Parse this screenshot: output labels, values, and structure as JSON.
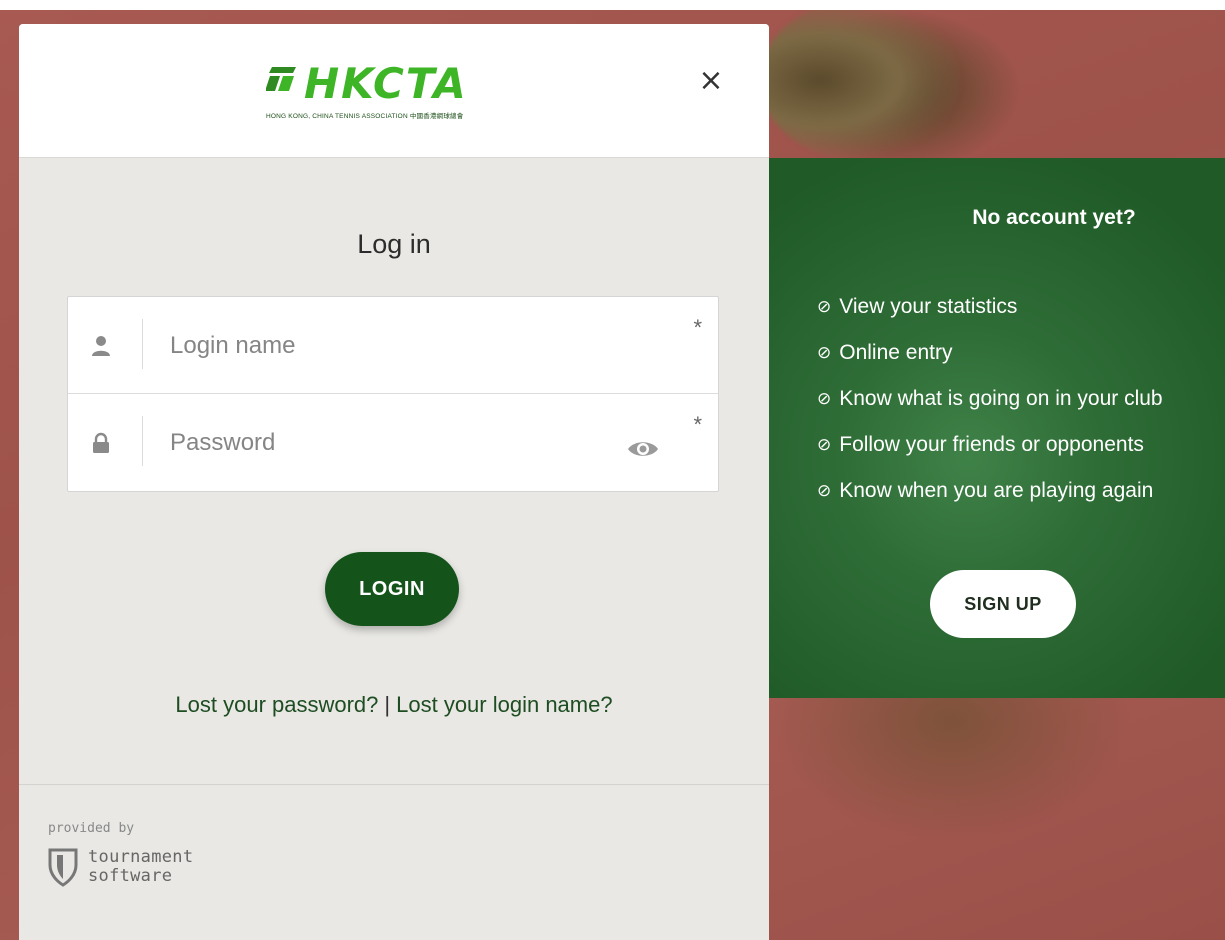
{
  "header": {
    "logo_acronym": "HKCTA",
    "logo_tagline": "HONG KONG, CHINA TENNIS ASSOCIATION 中國香港網球總會",
    "close_label": "×"
  },
  "login": {
    "title": "Log in",
    "login_name_placeholder": "Login name",
    "password_placeholder": "Password",
    "required_marker": "*",
    "login_button": "LOGIN",
    "lost_password": "Lost your password?",
    "separator": "|",
    "lost_login_name": "Lost your login name?"
  },
  "footer": {
    "provided_by": "provided by",
    "brand_line1": "tournament",
    "brand_line2": "software"
  },
  "signup": {
    "heading": "No account yet?",
    "check_icon": "⊘",
    "benefits": [
      "View your statistics",
      "Online entry",
      "Know what is going on in your club",
      "Follow your friends or opponents",
      "Know when you are playing again"
    ],
    "button": "SIGN UP"
  },
  "colors": {
    "primary_green": "#14541a",
    "panel_green": "#2f6d37",
    "logo_green": "#3eb526",
    "background_clay": "#a2574f"
  },
  "icons": {
    "user": "user-icon",
    "lock": "lock-icon",
    "eye": "eye-icon",
    "close": "close-icon",
    "check": "check-circle-icon",
    "shield": "tournament-software-shield-icon"
  }
}
